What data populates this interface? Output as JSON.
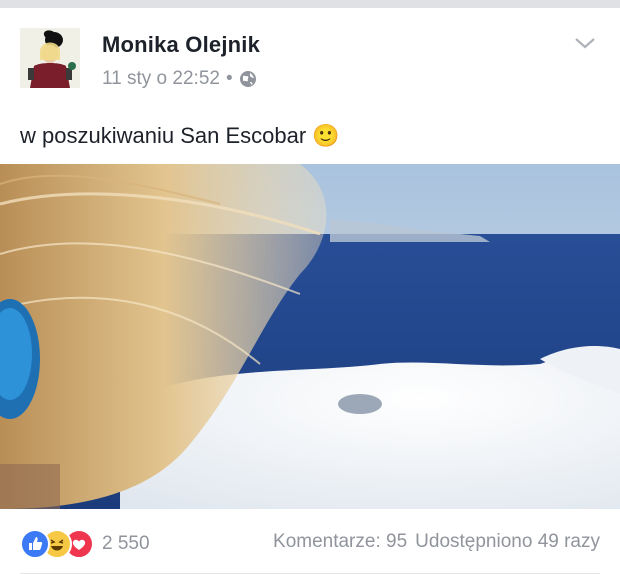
{
  "post": {
    "author": "Monika Olejnik",
    "timestamp": "11 sty o 22:52",
    "separator": "•",
    "privacy_icon": "globe-icon",
    "text": "w poszukiwaniu San Escobar",
    "emoji": "🙂"
  },
  "reactions": {
    "count": "2 550",
    "icons": [
      "like-icon",
      "haha-icon",
      "love-icon"
    ],
    "colors": {
      "like": "#3b79f5",
      "haha": "#f7c843",
      "love": "#f0364f"
    }
  },
  "stats": {
    "comments": "Komentarze: 95",
    "shares": "Udostępniono 49 razy"
  }
}
